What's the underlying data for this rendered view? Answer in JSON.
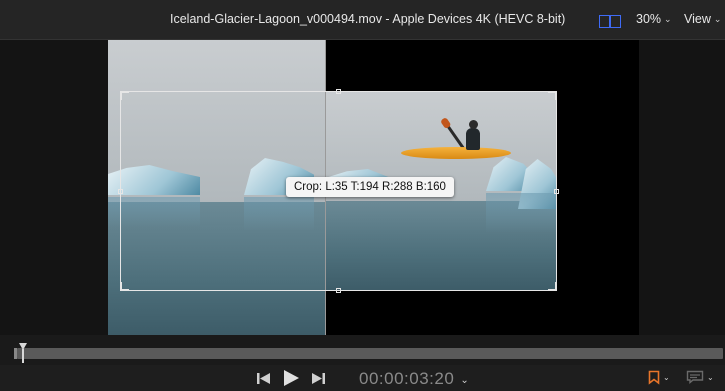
{
  "topbar": {
    "file_title": "Iceland-Glacier-Lagoon_v000494.mov - Apple Devices 4K (HEVC 8-bit)",
    "zoom": "30%",
    "view_label": "View",
    "layout_icon": "dual-viewer-icon",
    "accent": "#3f6bf5"
  },
  "viewer": {
    "crop_tooltip": "Crop: L:35 T:194 R:288 B:160"
  },
  "transport": {
    "timecode": "00:00:03:20",
    "icons": [
      "skip-back-icon",
      "play-icon",
      "skip-forward-icon",
      "marker-icon",
      "captions-icon"
    ],
    "marker_color": "#e8752a"
  }
}
